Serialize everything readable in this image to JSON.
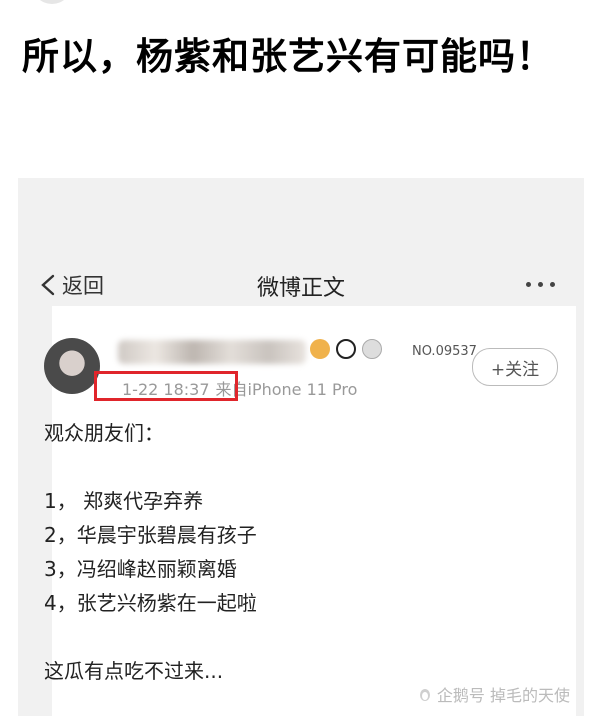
{
  "headline": "所以，杨紫和张艺兴有可能吗！",
  "screenshot": {
    "nav": {
      "back_label": "返回",
      "title": "微博正文"
    },
    "post": {
      "vip_number": "NO.09537",
      "follow_label": "+关注",
      "time": "1-22 18:37",
      "source": "来自iPhone 11 Pro",
      "lines": [
        "观众朋友们：",
        "",
        "1，  郑爽代孕弃养",
        "2，华晨宇张碧晨有孩子",
        "3，冯绍峰赵丽颖离婚",
        "4，张艺兴杨紫在一起啦",
        "",
        "这瓜有点吃不过来..."
      ]
    }
  },
  "watermark": "企鹅号 掉毛的天使",
  "colors": {
    "highlight_box": "#e0252b"
  },
  "icons": [
    "back-chevron-icon",
    "more-dots-icon",
    "penguin-icon"
  ]
}
